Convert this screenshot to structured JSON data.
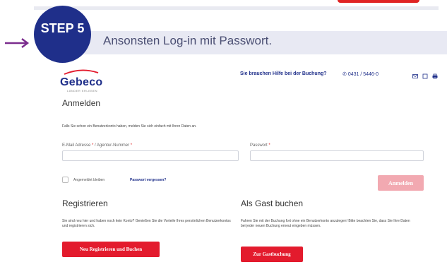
{
  "step": {
    "badge": "STEP 5",
    "text": "Ansonsten Log-in mit Passwort."
  },
  "brand": {
    "name": "Gebeco",
    "tagline": "LÄNDER ERLEBEN"
  },
  "header": {
    "help_text": "Sie brauchen Hilfe bei der Buchung?",
    "phone": "0431 / 5446-0"
  },
  "login": {
    "title": "Anmelden",
    "info": "Falls Sie schon ein Benutzerkonto haben, melden Sie sich einfach mit Ihren Daten an.",
    "email_label": "E-Mail Adresse",
    "email_label_rest": "/ Agentur-Nummer",
    "password_label": "Passwort",
    "remember": "Angemeldet bleiben",
    "forgot": "Passwort vergessen?",
    "submit": "Anmelden"
  },
  "register": {
    "title": "Registrieren",
    "text": "Sie sind neu hier und haben noch kein Konto? Genießen Sie die Vorteile Ihres persönlichen Benutzerkontos und registrieren sich.",
    "button": "Neu Registrieren und Buchen"
  },
  "guest": {
    "title": "Als Gast buchen",
    "text": "Fahren Sie mit der Buchung fort ohne ein Benutzerkonto anzulegen! Bitte beachten Sie, dass Sie Ihre Daten bei jeder neuen Buchung erneut eingeben müssen.",
    "button": "Zur Gastbuchung"
  },
  "colors": {
    "brand_blue": "#1f2f8a",
    "accent_red": "#e31b2d",
    "arrow": "#7b2d8e"
  }
}
